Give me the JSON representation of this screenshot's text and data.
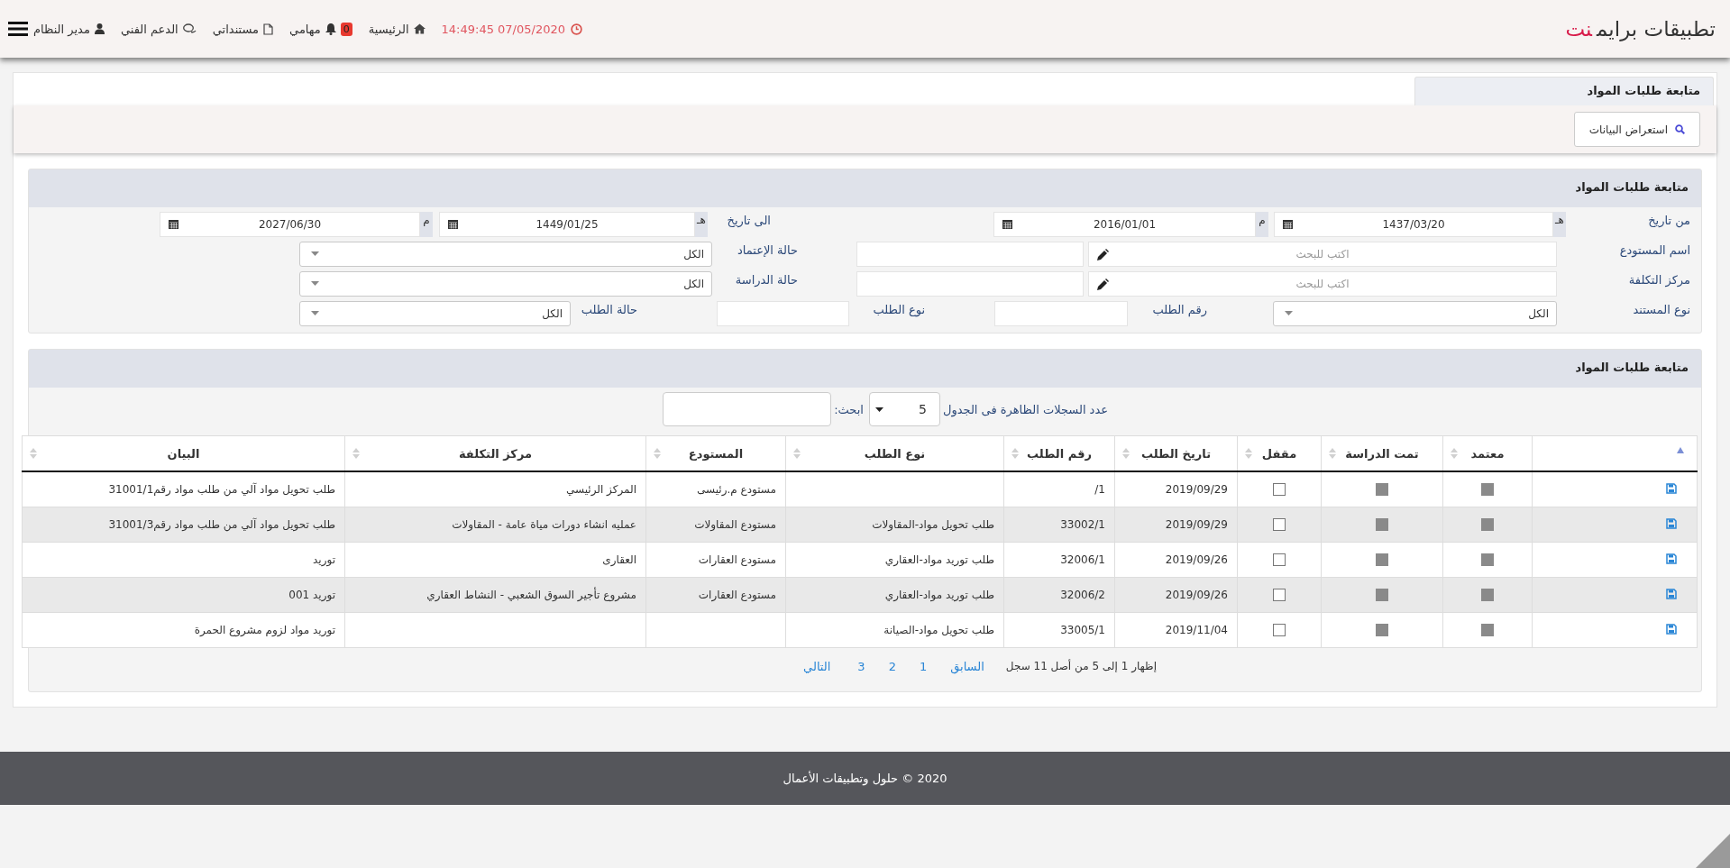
{
  "header": {
    "brand": "تطبيقات برايم",
    "brand_accent": "نت",
    "datetime": "14:49:45 07/05/2020",
    "nav": [
      {
        "kind": "home",
        "label": "الرئيسية"
      },
      {
        "kind": "tasks",
        "label": "مهامي",
        "badge": "0"
      },
      {
        "kind": "documents",
        "label": "مستنداتي"
      },
      {
        "kind": "support",
        "label": "الدعم الفني"
      },
      {
        "kind": "user",
        "label": "مدير النظام"
      }
    ]
  },
  "page_tab": {
    "label": "متابعة طلبات المواد",
    "selected": true
  },
  "toolbar": {
    "button": "استعراض البيانات"
  },
  "filter_panel": {
    "title": "متابعة طلبات المواد",
    "rows": [
      [
        {
          "kind": "label",
          "text": "من تاريخ"
        },
        {
          "kind": "date",
          "addon": "هـ",
          "value": "1437/03/20"
        },
        {
          "kind": "date",
          "addon": "م",
          "value": "2016/01/01"
        },
        {
          "kind": "label",
          "text": "الى تاريخ"
        },
        {
          "kind": "date",
          "addon": "هـ",
          "value": "1449/01/25"
        },
        {
          "kind": "date",
          "addon": "م",
          "value": "2027/06/30"
        }
      ],
      [
        {
          "kind": "label",
          "text": "اسم المستودع"
        },
        {
          "kind": "search",
          "placeholder": "اكتب للبحث"
        },
        {
          "kind": "text"
        },
        {
          "kind": "label",
          "text": "حالة الإعتماد"
        },
        {
          "kind": "select",
          "value": "الكل"
        }
      ],
      [
        {
          "kind": "label",
          "text": "مركز التكلفة"
        },
        {
          "kind": "search",
          "placeholder": "اكتب للبحث"
        },
        {
          "kind": "text"
        },
        {
          "kind": "label",
          "text": "حالة الدراسة"
        },
        {
          "kind": "select",
          "value": "الكل"
        }
      ],
      [
        {
          "kind": "label",
          "text": "نوع المستند"
        },
        {
          "kind": "select",
          "value": "الكل"
        },
        {
          "kind": "label",
          "text": "رقم الطلب"
        },
        {
          "kind": "text"
        },
        {
          "kind": "label",
          "text": "نوع الطلب"
        },
        {
          "kind": "text"
        },
        {
          "kind": "label",
          "text": "حالة الطلب"
        },
        {
          "kind": "select",
          "value": "الكل"
        }
      ]
    ]
  },
  "table_panel": {
    "title": "متابعة طلبات المواد",
    "page_size_label": "عدد السجلات الظاهرة فى الجدول",
    "page_size": "5",
    "search_label": "ابحث:",
    "table": {
      "columns": [
        {
          "sorted": true
        },
        {
          "label": "معتمد",
          "sorted": false
        },
        {
          "label": "تمت الدراسة",
          "sorted": false
        },
        {
          "label": "مقفل",
          "sorted": false
        },
        {
          "label": "تاريخ الطلب",
          "sorted": false
        },
        {
          "label": "رقم الطلب",
          "sorted": false
        },
        {
          "label": "نوع الطلب",
          "sorted": false
        },
        {
          "label": "المستودع",
          "sorted": false
        },
        {
          "label": "مركز التكلفة",
          "sorted": false
        },
        {
          "label": "البيان",
          "sorted": false
        }
      ],
      "rows": [
        {
          "approved": true,
          "studied": true,
          "locked": false,
          "date": "2019/09/29",
          "number": "1/",
          "warehouse": "مستودع م.رئيسى",
          "cost_center": "المركز الرئيسي",
          "description": "طلب تحويل مواد آلي من طلب مواد رقم31001/1"
        },
        {
          "approved": true,
          "studied": true,
          "locked": false,
          "date": "2019/09/29",
          "number": "33002/1",
          "type": "طلب تحويل مواد-المقاولات",
          "warehouse": "مستودع المقاولات",
          "cost_center": "عمليه انشاء دورات مياة عامة - المقاولات",
          "description": "طلب تحويل مواد آلي من طلب مواد رقم31001/3"
        },
        {
          "approved": true,
          "studied": true,
          "locked": false,
          "date": "2019/09/26",
          "number": "32006/1",
          "type": "طلب توريد مواد-العقاري",
          "warehouse": "مستودع العقارات",
          "cost_center": "العقارى",
          "description": "توريد"
        },
        {
          "approved": true,
          "studied": true,
          "locked": false,
          "date": "2019/09/26",
          "number": "32006/2",
          "type": "طلب توريد مواد-العقاري",
          "warehouse": "مستودع العقارات",
          "cost_center": "مشروع تأجير السوق الشعبي - النشاط العقاري",
          "description": "توريد 001"
        },
        {
          "approved": true,
          "studied": true,
          "locked": false,
          "date": "2019/11/04",
          "number": "33005/1",
          "type": "طلب تحويل مواد-الصيانة",
          "description": "توريد مواد لزوم مشروع الحمرة"
        }
      ]
    },
    "info": "إظهار 1 إلى 5 من أصل 11 سجل",
    "pagination": [
      "السابق",
      "1",
      "2",
      "3",
      "التالي"
    ]
  },
  "footer": {
    "text": "2020 © حلول وتطبيقات الأعمال"
  }
}
